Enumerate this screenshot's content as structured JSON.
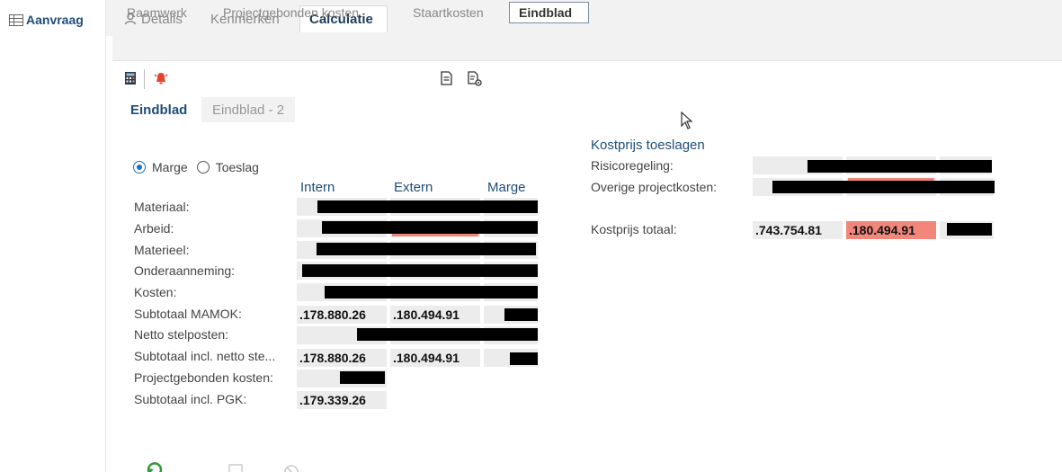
{
  "sidebar": {
    "items": [
      {
        "label": "Aanvraag",
        "icon": "table-icon"
      }
    ]
  },
  "tabs": {
    "top": [
      {
        "label": "Details",
        "icon": "user-icon"
      },
      {
        "label": "Kenmerken"
      },
      {
        "label": "Calculatie",
        "active": true
      }
    ],
    "sub": [
      {
        "label": "Raamwerk"
      },
      {
        "label": "Projectgebonden kosten"
      },
      {
        "label": "Staartkosten"
      },
      {
        "label": "Eindblad",
        "active": true
      }
    ],
    "inner": [
      {
        "label": "Eindblad",
        "active": true
      },
      {
        "label": "Eindblad - 2"
      }
    ]
  },
  "toolbar": {
    "icons": [
      "calculator-icon",
      "alarm-bell-icon",
      "document-icon",
      "document-settings-icon"
    ]
  },
  "mode": {
    "options": [
      {
        "label": "Marge",
        "checked": true
      },
      {
        "label": "Toeslag",
        "checked": false
      }
    ]
  },
  "columns": [
    "Intern",
    "Extern",
    "Marge"
  ],
  "rows": [
    {
      "label": "Materiaal:"
    },
    {
      "label": "Arbeid:"
    },
    {
      "label": "Materieel:"
    },
    {
      "label": "Onderaanneming:"
    },
    {
      "label": "Kosten:"
    },
    {
      "label": "Subtotaal MAMOK:",
      "intern": ".178.880.26",
      "extern": ".180.494.91"
    },
    {
      "label": "Netto stelposten:"
    },
    {
      "label": "Subtotaal incl. netto ste...",
      "intern": ".178.880.26",
      "extern": ".180.494.91"
    },
    {
      "label": "Projectgebonden kosten:"
    },
    {
      "label": "Subtotaal incl. PGK:",
      "intern": ".179.339.26"
    }
  ],
  "kostprijs": {
    "title": "Kostprijs toeslagen",
    "rows": [
      {
        "label": "Risicoregeling:"
      },
      {
        "label": "Overige projectkosten:"
      }
    ],
    "total": {
      "label": "Kostprijs totaal:",
      "intern": ".743.754.81",
      "extern": ".180.494.91"
    }
  },
  "colors": {
    "accent": "#1f4e79",
    "highlight_red": "#f0877a",
    "cell_bg": "#ececec",
    "redaction": "#000000"
  },
  "bottom_icons": [
    "refresh-icon",
    "save-icon",
    "cancel-icon"
  ]
}
